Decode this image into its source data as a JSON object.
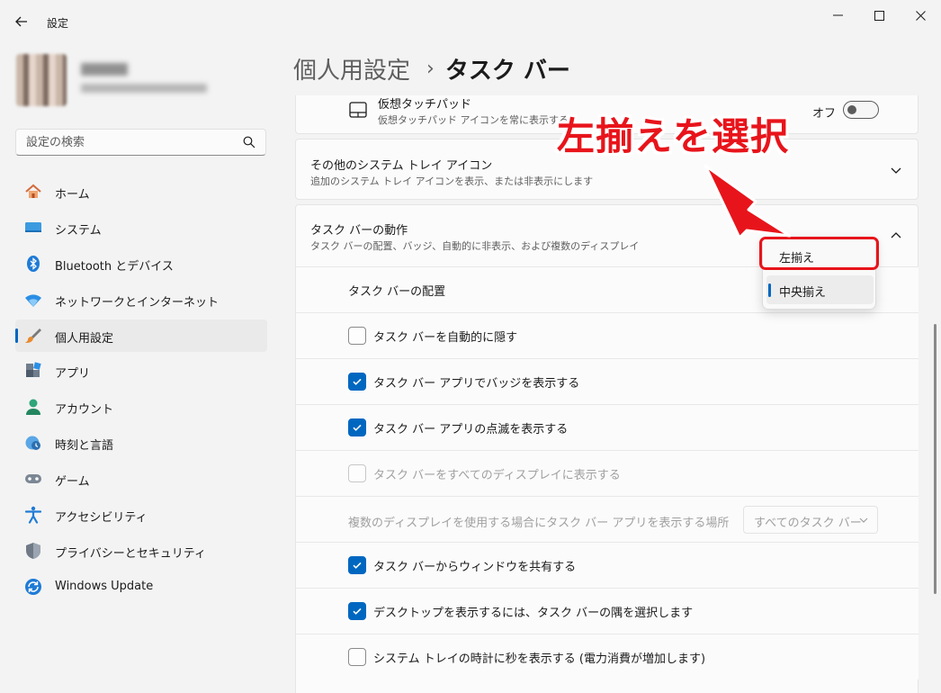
{
  "window": {
    "title": "設定"
  },
  "search": {
    "placeholder": "設定の検索"
  },
  "sidebar": {
    "items": [
      {
        "label": "ホーム",
        "icon": "home-icon"
      },
      {
        "label": "システム",
        "icon": "system-icon"
      },
      {
        "label": "Bluetooth とデバイス",
        "icon": "bluetooth-icon"
      },
      {
        "label": "ネットワークとインターネット",
        "icon": "network-icon"
      },
      {
        "label": "個人用設定",
        "icon": "personalization-icon",
        "active": true
      },
      {
        "label": "アプリ",
        "icon": "apps-icon"
      },
      {
        "label": "アカウント",
        "icon": "account-icon"
      },
      {
        "label": "時刻と言語",
        "icon": "time-language-icon"
      },
      {
        "label": "ゲーム",
        "icon": "gaming-icon"
      },
      {
        "label": "アクセシビリティ",
        "icon": "accessibility-icon"
      },
      {
        "label": "プライバシーとセキュリティ",
        "icon": "privacy-shield-icon"
      },
      {
        "label": "Windows Update",
        "icon": "windows-update-icon"
      }
    ]
  },
  "header": {
    "parent": "個人用設定",
    "separator": "›",
    "current": "タスク バー"
  },
  "touchpad": {
    "title": "仮想タッチパッド",
    "desc": "仮想タッチパッド アイコンを常に表示する",
    "toggle_label": "オフ",
    "toggle_on": false
  },
  "tray_icons": {
    "title": "その他のシステム トレイ アイコン",
    "desc": "追加のシステム トレイ アイコンを表示、または非表示にします"
  },
  "behaviors": {
    "title": "タスク バーの動作",
    "desc": "タスク バーの配置、バッジ、自動的に非表示、および複数のディスプレイ",
    "alignment_label": "タスク バーの配置",
    "rows": [
      {
        "label": "タスク バーを自動的に隠す",
        "checked": false,
        "disabled": false
      },
      {
        "label": "タスク バー アプリでバッジを表示する",
        "checked": true,
        "disabled": false
      },
      {
        "label": "タスク バー アプリの点滅を表示する",
        "checked": true,
        "disabled": false
      },
      {
        "label": "タスク バーをすべてのディスプレイに表示する",
        "checked": false,
        "disabled": true
      }
    ],
    "multi_display": {
      "label": "複数のディスプレイを使用する場合にタスク バー アプリを表示する場所",
      "value": "すべてのタスク バー"
    },
    "rows2": [
      {
        "label": "タスク バーからウィンドウを共有する",
        "checked": true
      },
      {
        "label": "デスクトップを表示するには、タスク バーの隅を選択します",
        "checked": true
      },
      {
        "label": "システム トレイの時計に秒を表示する (電力消費が増加します)",
        "checked": false
      }
    ]
  },
  "alignment_dropdown": {
    "options": [
      "左揃え",
      "中央揃え"
    ],
    "selected": "中央揃え"
  },
  "annotation": {
    "text": "左揃えを選択",
    "color": "#e8141b"
  },
  "colors": {
    "accent": "#0067c0",
    "background": "#f3f3f3",
    "card": "#fbfbfb"
  }
}
